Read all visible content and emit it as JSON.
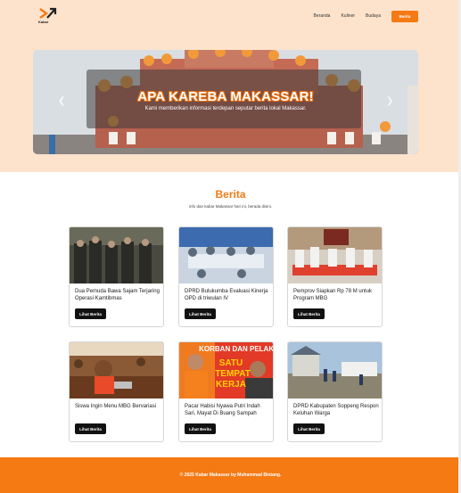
{
  "brand": {
    "name": "Kabar",
    "accent": "#f57a14"
  },
  "nav": {
    "links": [
      "Beranda",
      "Kuliner",
      "Budaya"
    ],
    "cta": "Berita"
  },
  "hero": {
    "title": "APA KAREBA MAKASSAR!",
    "subtitle": "Kami memberikan informasi terdepan seputar berita lokal Makassar.",
    "prev_icon": "chevron-left-icon",
    "next_icon": "chevron-right-icon"
  },
  "section": {
    "title": "Berita",
    "subtitle": "info dan kabar Makassar hari ini, berada disini."
  },
  "cards": [
    {
      "title": "Dua Pemuda Bawa Sajam Terjaring Operasi Kamtibmas",
      "button": "Lihat Berita"
    },
    {
      "title": "DPRD Bulukumba Evaluasi Kinerja OPD di triwulan IV",
      "button": "Lihat Berita"
    },
    {
      "title": "Pemprov Siapkan Rp 78 M untuk Program MBG",
      "button": "Lihat Berita"
    },
    {
      "title": "Siswa Ingin Menu MBG Bervariasi",
      "button": "Lihat Berita"
    },
    {
      "title": "Pacar Habisi Nyawa Putri Indah Sari, Mayat Di Buang Sampah",
      "button": "Lihat Berita"
    },
    {
      "title": "DPRD Kabupaten Soppeng Respon Keluhan Warga",
      "button": "Lihat Berita"
    }
  ],
  "card_image_text": {
    "line1": "KORBAN DAN PELAKU",
    "line2": "SATU",
    "line3": "TEMPAT",
    "line4": "KERJA"
  },
  "footer": {
    "text": "© 2025 Kabar Makassar by Muhammad Bintang."
  }
}
